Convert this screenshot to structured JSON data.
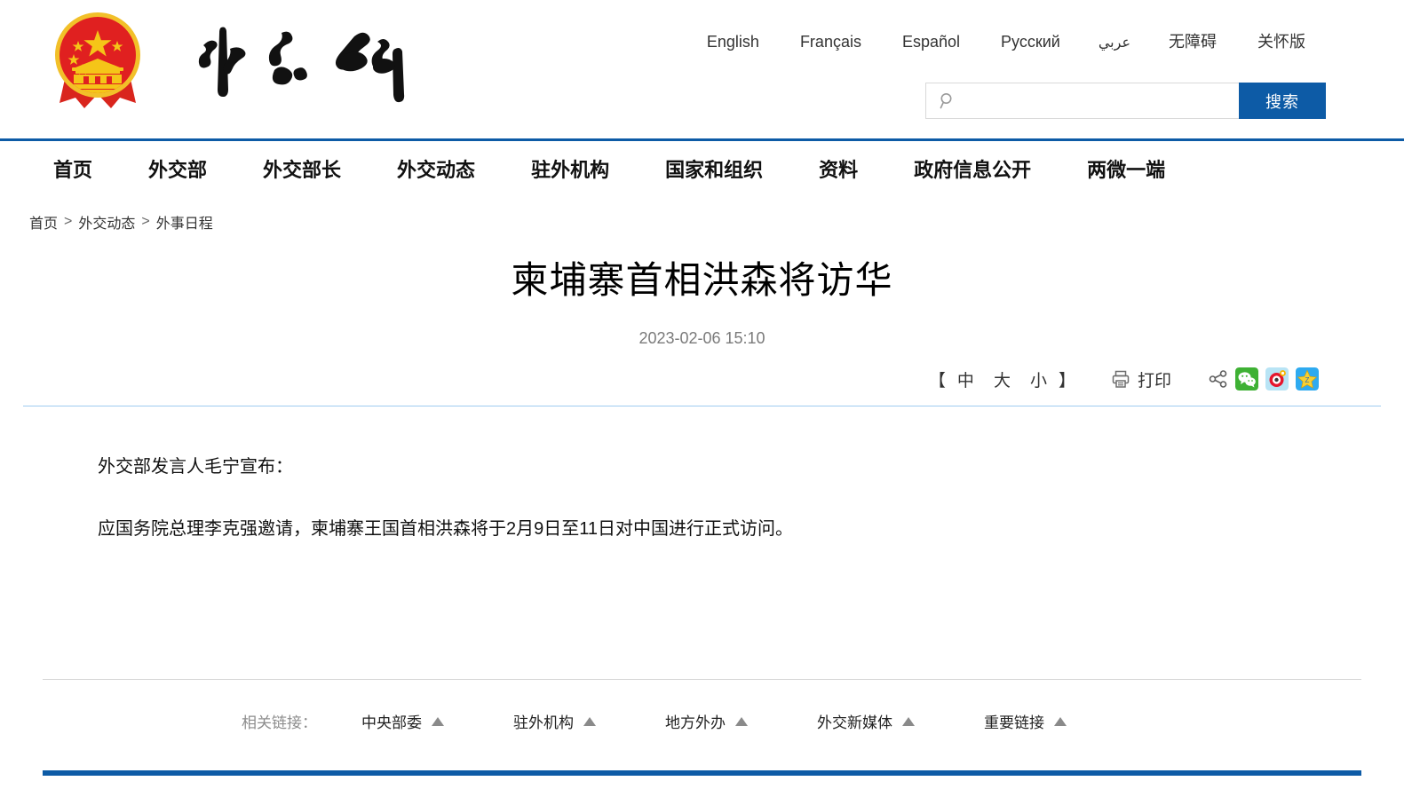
{
  "site": {
    "emblem_icon": "china-national-emblem",
    "wordmark_text": "外交部",
    "wordmark_icon": "mfa-calligraphy-wordmark"
  },
  "header": {
    "languages": [
      {
        "label": "English",
        "name": "english"
      },
      {
        "label": "Français",
        "name": "francais"
      },
      {
        "label": "Español",
        "name": "espanol"
      },
      {
        "label": "Русский",
        "name": "russian"
      },
      {
        "label": "عربي",
        "name": "arabic"
      }
    ],
    "utility_links": [
      {
        "label": "无障碍",
        "name": "accessibility"
      },
      {
        "label": "关怀版",
        "name": "care-version"
      }
    ],
    "search": {
      "icon": "search-icon",
      "value": "",
      "placeholder": "",
      "button_label": "搜索"
    }
  },
  "nav": {
    "items": [
      {
        "label": "首页",
        "name": "home"
      },
      {
        "label": "外交部",
        "name": "ministry"
      },
      {
        "label": "外交部长",
        "name": "minister"
      },
      {
        "label": "外交动态",
        "name": "news"
      },
      {
        "label": "驻外机构",
        "name": "missions"
      },
      {
        "label": "国家和组织",
        "name": "countries-organizations"
      },
      {
        "label": "资料",
        "name": "resources"
      },
      {
        "label": "政府信息公开",
        "name": "government-info"
      },
      {
        "label": "两微一端",
        "name": "social-media"
      }
    ]
  },
  "breadcrumb": {
    "items": [
      "首页",
      "外交动态",
      "外事日程"
    ],
    "separator": ">"
  },
  "article": {
    "title": "柬埔寨首相洪森将访华",
    "date": "2023-02-06 15:10",
    "paragraphs": [
      "外交部发言人毛宁宣布：",
      "应国务院总理李克强邀请，柬埔寨王国首相洪森将于2月9日至11日对中国进行正式访问。"
    ]
  },
  "toolbar": {
    "bracket_open": "【",
    "bracket_close": "】",
    "font_sizes": [
      {
        "label": "中",
        "name": "font-medium"
      },
      {
        "label": "大",
        "name": "font-large"
      },
      {
        "label": "小",
        "name": "font-small"
      }
    ],
    "print_label": "打印",
    "print_icon": "printer-icon",
    "share_icon": "share-icon",
    "social": [
      {
        "name": "wechat-icon",
        "label": "微信",
        "color": "#3eb134"
      },
      {
        "name": "weibo-icon",
        "label": "微博",
        "color": "#e6162d"
      },
      {
        "name": "qzone-icon",
        "label": "QQ空间",
        "color": "#2eaaf0"
      }
    ]
  },
  "footer": {
    "related_label": "相关链接：",
    "related_items": [
      {
        "label": "中央部委",
        "name": "central-ministries"
      },
      {
        "label": "驻外机构",
        "name": "overseas-missions"
      },
      {
        "label": "地方外办",
        "name": "local-foreign-affairs"
      },
      {
        "label": "外交新媒体",
        "name": "diplomatic-new-media"
      },
      {
        "label": "重要链接",
        "name": "important-links"
      }
    ],
    "caret_icon": "caret-up-icon"
  },
  "colors": {
    "brand_blue": "#0d5ba6",
    "emblem_red": "#e02020",
    "emblem_gold": "#f5c518",
    "divider_blue": "#9ecbf0",
    "divider_gray": "#d5d5d5"
  }
}
